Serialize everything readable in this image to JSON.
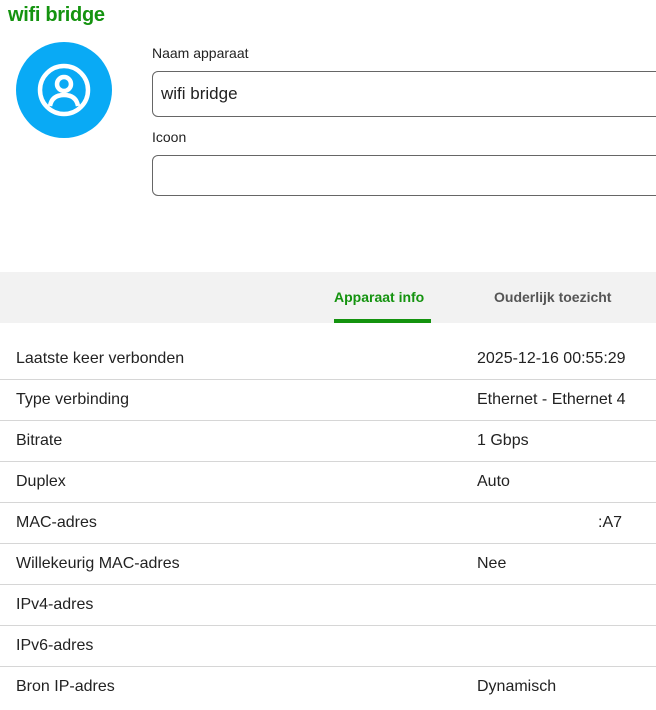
{
  "header": {
    "title": "wifi bridge"
  },
  "form": {
    "name_label": "Naam apparaat",
    "name_value": "wifi bridge",
    "icon_label": "Icoon",
    "icon_value": ""
  },
  "tabs": [
    {
      "label": "Apparaat info",
      "active": true
    },
    {
      "label": "Ouderlijk toezicht",
      "active": false
    }
  ],
  "info": [
    {
      "label": "Laatste keer verbonden",
      "value": "2025-12-16 00:55:29"
    },
    {
      "label": "Type verbinding",
      "value": "Ethernet - Ethernet 4"
    },
    {
      "label": "Bitrate",
      "value": "1 Gbps"
    },
    {
      "label": "Duplex",
      "value": "Auto"
    },
    {
      "label": "MAC-adres",
      "value": ":A7"
    },
    {
      "label": "Willekeurig MAC-adres",
      "value": "Nee"
    },
    {
      "label": "IPv4-adres",
      "value": ""
    },
    {
      "label": "IPv6-adres",
      "value": ""
    },
    {
      "label": "Bron IP-adres",
      "value": "Dynamisch"
    }
  ]
}
